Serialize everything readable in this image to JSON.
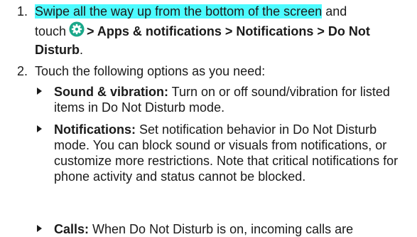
{
  "step1": {
    "number": "1.",
    "highlight": "Swipe all the way up from the bottom of the screen",
    "and": " and",
    "touch": "touch",
    "path": "> Apps & notifications > Notifications > Do Not Disturb",
    "end": "."
  },
  "step2": {
    "number": "2.",
    "text": "Touch the following options as you need:"
  },
  "bullets": [
    {
      "term": "Sound & vibration:",
      "desc": " Turn on or off sound/vibration for listed items in Do Not Disturb mode."
    },
    {
      "term": "Notifications:",
      "desc": " Set notification behavior in Do Not Disturb mode. You can block sound or visuals from notifications, or customize more restrictions. Note that critical notifications for phone activity and status cannot be blocked."
    },
    {
      "term": "Calls:",
      "desc": " When Do Not Disturb is on, incoming calls are"
    }
  ],
  "icons": {
    "settings": "settings-gear-icon",
    "bullet": "triangle-bullet-icon"
  },
  "colors": {
    "highlight": "#4dfbff",
    "icon": "#1aa88a",
    "text": "#1a1a1a"
  }
}
